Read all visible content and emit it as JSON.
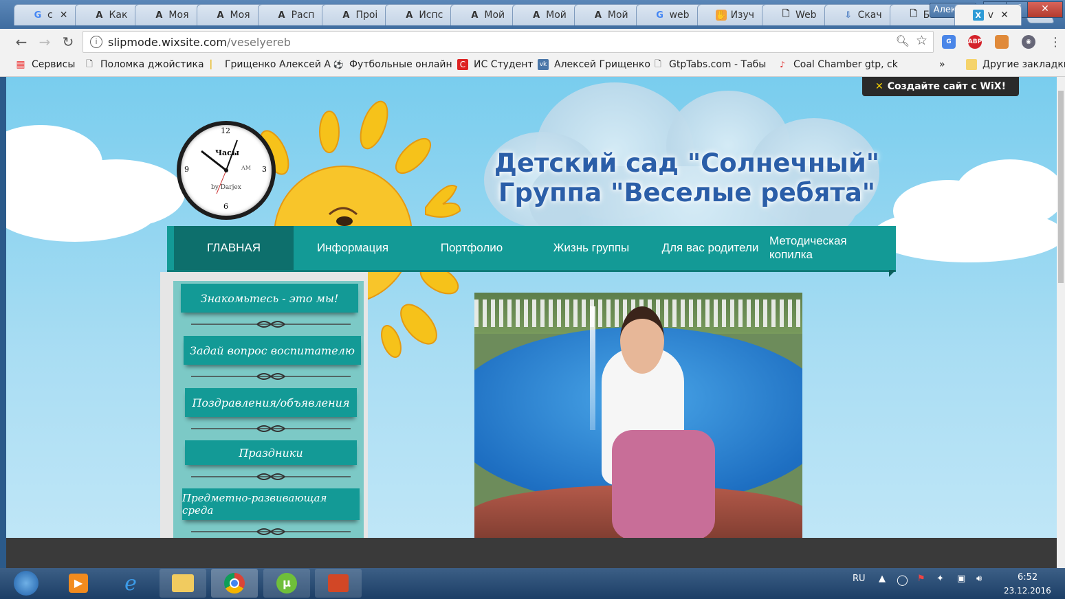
{
  "browser": {
    "tabs": [
      {
        "icon": "google-icon",
        "label": "с"
      },
      {
        "icon": "font-a-icon",
        "label": "Как"
      },
      {
        "icon": "font-a-icon",
        "label": "Моя"
      },
      {
        "icon": "font-a-icon",
        "label": "Моя"
      },
      {
        "icon": "font-a-icon",
        "label": "Расп"
      },
      {
        "icon": "font-a-icon",
        "label": "Проі"
      },
      {
        "icon": "font-a-icon",
        "label": "Испс"
      },
      {
        "icon": "font-a-icon",
        "label": "Мой"
      },
      {
        "icon": "font-a-icon",
        "label": "Мой"
      },
      {
        "icon": "font-a-icon",
        "label": "Мой"
      },
      {
        "icon": "google-icon",
        "label": "web"
      },
      {
        "icon": "hand-icon",
        "label": "Изуч"
      },
      {
        "icon": "page-icon",
        "label": "Web"
      },
      {
        "icon": "download-icon",
        "label": "Скач"
      },
      {
        "icon": "page-icon",
        "label": "Бого"
      },
      {
        "icon": "wix-icon",
        "label": "v"
      }
    ],
    "user_name": "Алексей",
    "address": {
      "host": "slipmode.wixsite.com",
      "path": "/veselyereb"
    },
    "bookmarks": [
      {
        "icon": "apps-icon",
        "label": "Сервисы"
      },
      {
        "icon": "page-icon",
        "label": "Поломка джойстика"
      },
      {
        "icon": "page-icon",
        "label": "Грищенко Алексей А"
      },
      {
        "icon": "soccer-icon",
        "label": "Футбольные онлайн"
      },
      {
        "icon": "student-icon",
        "label": "ИС Студент"
      },
      {
        "icon": "vk-icon",
        "label": "Алексей Грищенко"
      },
      {
        "icon": "page-icon",
        "label": "GtpTabs.com - Табы"
      },
      {
        "icon": "guitar-icon",
        "label": "Coal Chamber gtp, сk"
      }
    ],
    "bookmarks_more": "»",
    "other_bookmarks": "Другие закладки",
    "extensions": {
      "abp": "ABP"
    }
  },
  "site": {
    "wix_banner": "Создайте сайт с WiX!",
    "title_line1": "Детский сад \"Солнечный\"",
    "title_line2": "Группа \"Веселые ребята\"",
    "clock": {
      "label": "Часы",
      "brand": "by Darjex",
      "ampm": "AM",
      "n12": "12",
      "n3": "3",
      "n6": "6",
      "n9": "9"
    },
    "menu": [
      {
        "label": "ГЛАВНАЯ",
        "active": true
      },
      {
        "label": "Информация",
        "active": false
      },
      {
        "label": "Портфолио",
        "active": false
      },
      {
        "label": "Жизнь группы",
        "active": false
      },
      {
        "label": "Для вас родители",
        "active": false
      },
      {
        "label": "Методическая копилка",
        "active": false
      }
    ],
    "sidebar": [
      "Знакомьтесь - это мы!",
      "Задай вопрос воспитателю",
      "Поздравления/объявления",
      "Праздники",
      "Предметно-развивающая среда"
    ],
    "colors": {
      "menu": "#139a96",
      "menu_active": "#0d6f6c",
      "title": "#2b5ea8",
      "sidebar_bg": "#7cc9c6"
    }
  },
  "taskbar": {
    "apps": [
      "windows-start-icon",
      "media-player-icon",
      "internet-explorer-icon",
      "file-explorer-icon",
      "chrome-icon",
      "utorrent-icon",
      "presentation-icon"
    ],
    "lang": "RU",
    "time": "6:52",
    "date": "23.12.2016"
  }
}
